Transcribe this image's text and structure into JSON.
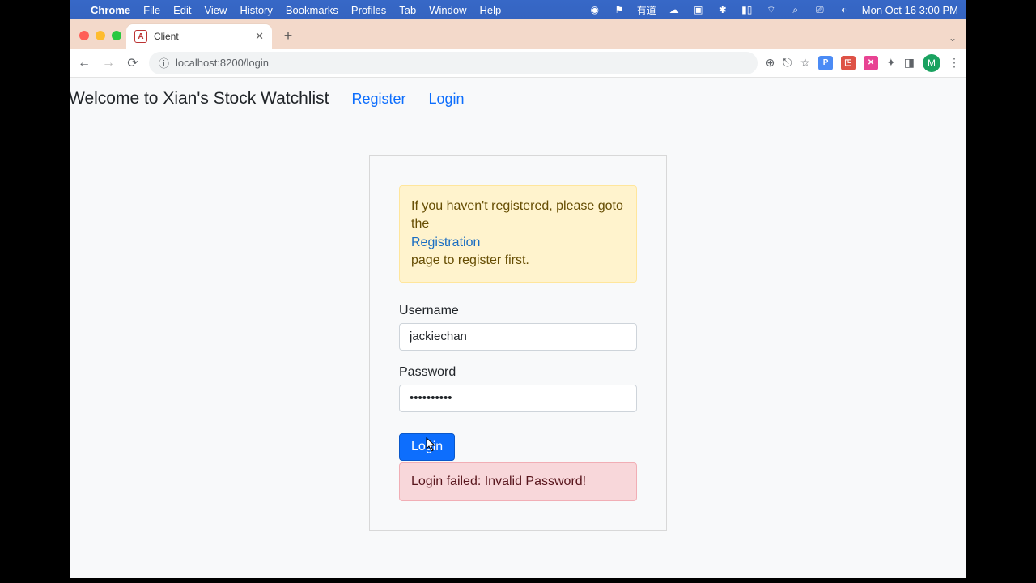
{
  "menubar": {
    "app": "Chrome",
    "items": [
      "File",
      "Edit",
      "View",
      "History",
      "Bookmarks",
      "Profiles",
      "Tab",
      "Window",
      "Help"
    ],
    "status_cn": "有道",
    "clock": "Mon Oct 16  3:00 PM"
  },
  "browser": {
    "tab_title": "Client",
    "url": "localhost:8200/login",
    "avatar_initial": "M"
  },
  "header": {
    "title": "Welcome to Xian's Stock Watchlist",
    "register": "Register",
    "login": "Login"
  },
  "card": {
    "notice_pre": "If you haven't registered, please goto the",
    "notice_link": "Registration",
    "notice_post": "page to register first.",
    "username_label": "Username",
    "username_value": "jackiechan",
    "password_label": "Password",
    "password_value": "••••••••••",
    "submit_label": "Login",
    "error": "Login failed: Invalid Password!"
  }
}
